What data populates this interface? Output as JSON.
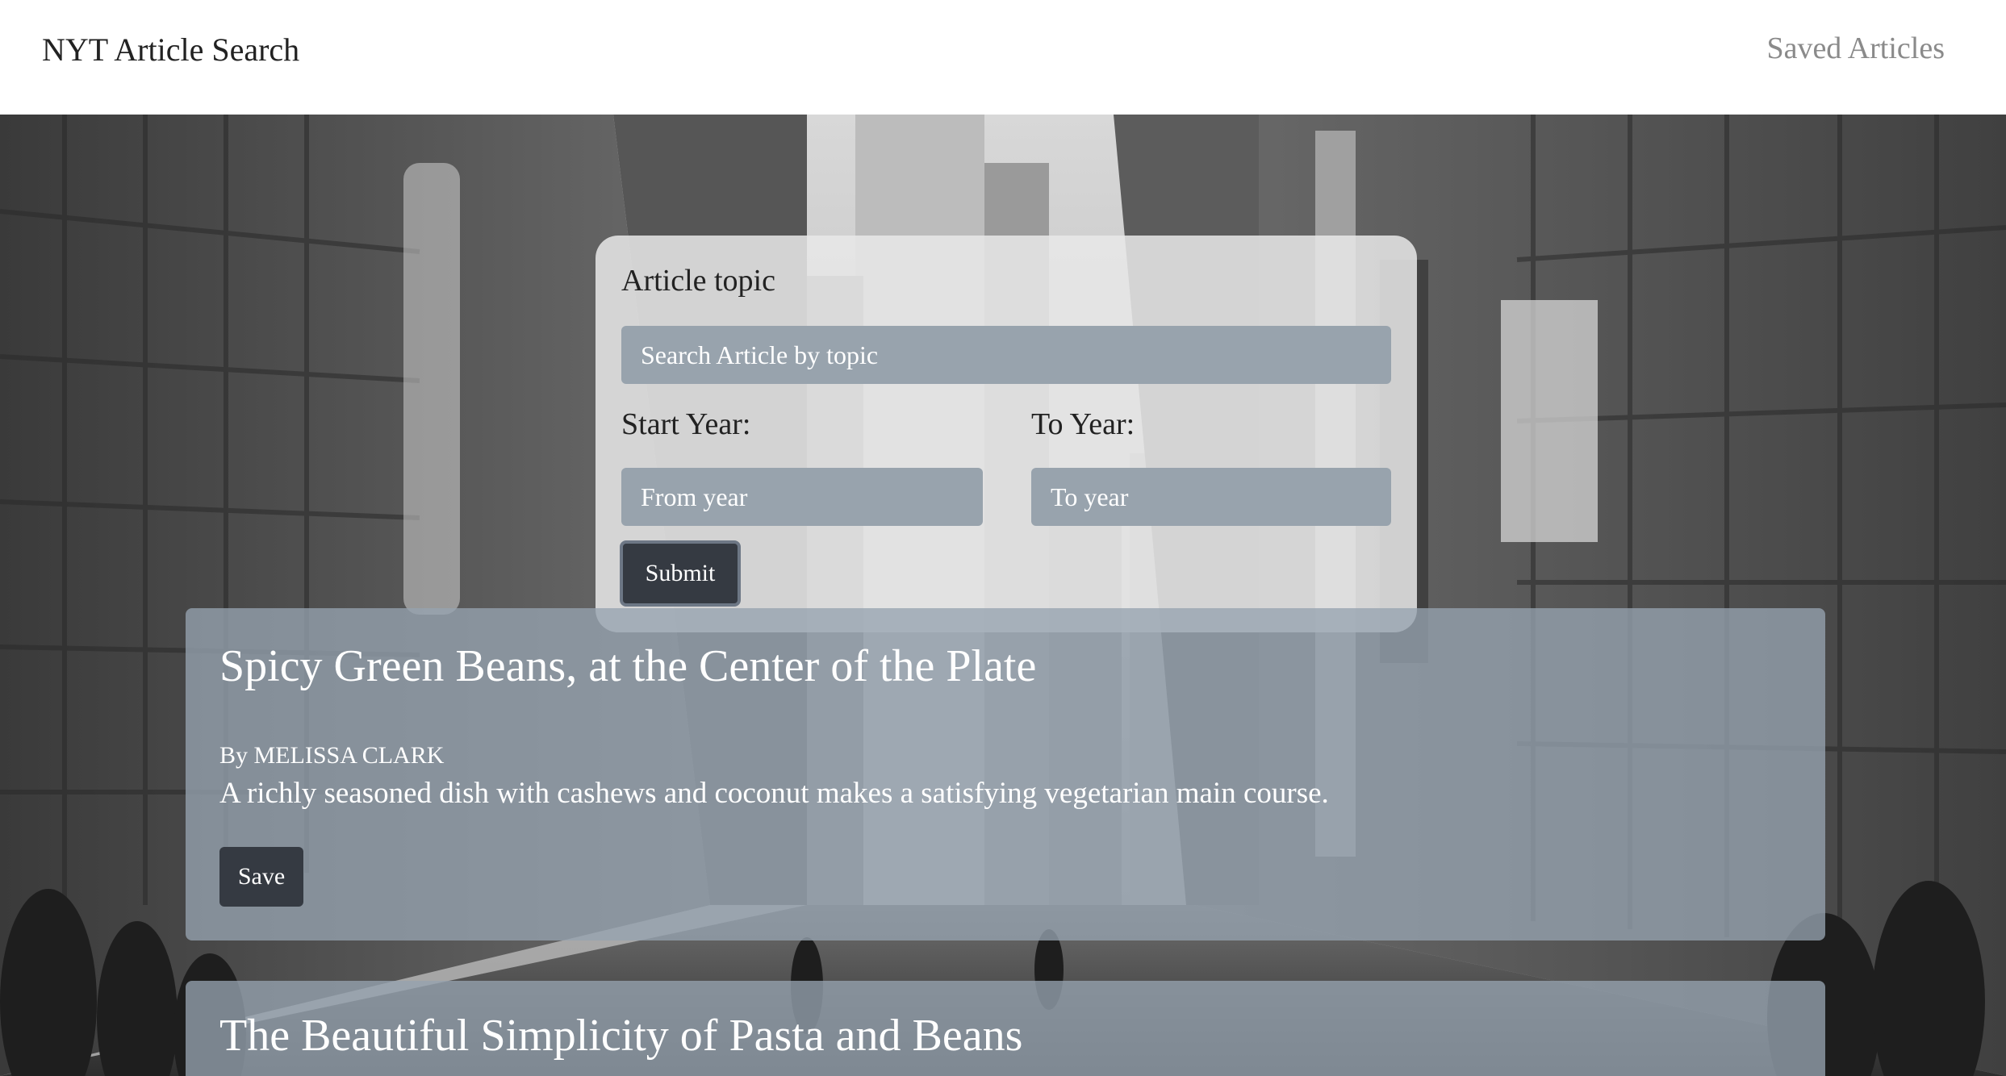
{
  "navbar": {
    "brand": "NYT Article Search",
    "saved_link": "Saved Articles"
  },
  "search": {
    "topic_label": "Article topic",
    "topic_placeholder": "Search Article by topic",
    "start_label": "Start Year:",
    "start_placeholder": "From year",
    "end_label": "To Year:",
    "end_placeholder": "To year",
    "submit_label": "Submit"
  },
  "articles": [
    {
      "title": "Spicy Green Beans, at the Center of the Plate",
      "byline": "By MELISSA CLARK",
      "snippet": "A richly seasoned dish with cashews and coconut makes a satisfying vegetarian main course.",
      "save_label": "Save"
    },
    {
      "title": "The Beautiful Simplicity of Pasta and Beans"
    }
  ],
  "colors": {
    "input_bg": "#98a3ad",
    "button_bg": "#353a42",
    "card_bg": "#e8e8e8",
    "article_bg": "#96a3af"
  }
}
